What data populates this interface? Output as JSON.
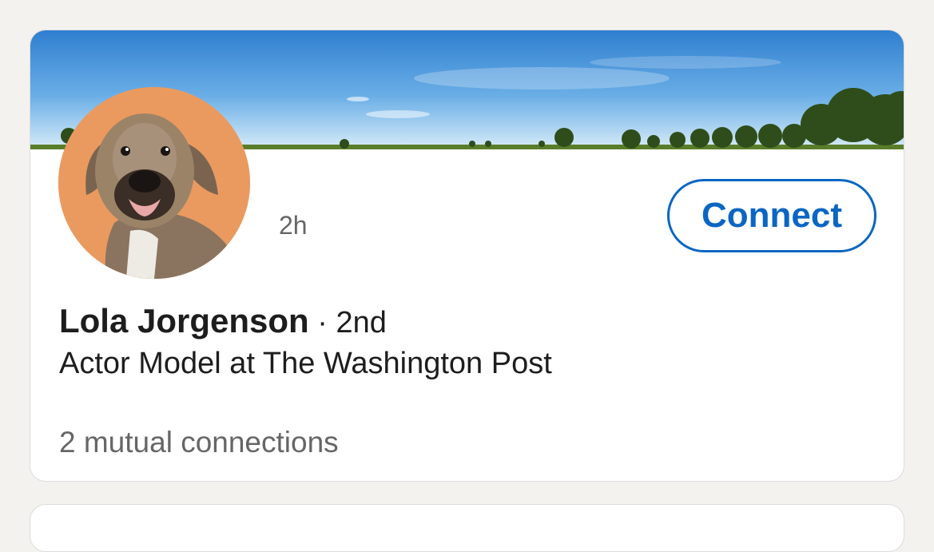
{
  "card": {
    "time_ago": "2h",
    "connect_label": "Connect",
    "name": "Lola Jorgenson",
    "degree": " · 2nd",
    "headline": "Actor Model at The Washington Post",
    "mutual": "2 mutual connections"
  },
  "colors": {
    "accent": "#0a66c2",
    "avatar_bg": "#ea9a5f"
  },
  "images": {
    "banner": "sky-landscape-banner",
    "avatar": "dog-profile-photo"
  }
}
